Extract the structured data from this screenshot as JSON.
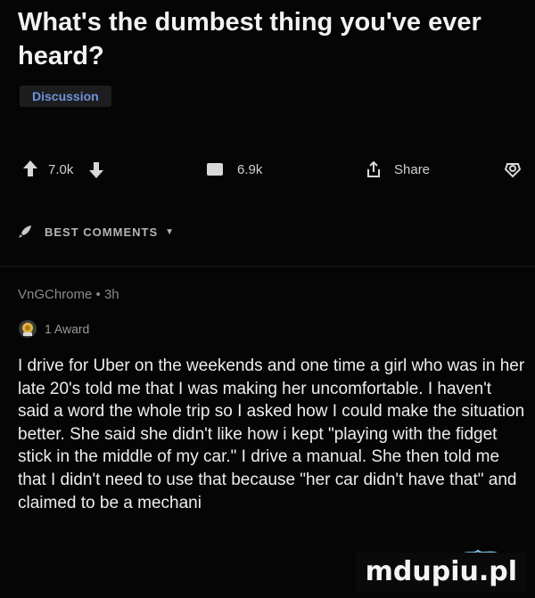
{
  "post": {
    "title": "What's the dumbest thing you've ever heard?",
    "flair": "Discussion"
  },
  "actions": {
    "upvote_icon": "arrow-up-icon",
    "score": "7.0k",
    "downvote_icon": "arrow-down-icon",
    "comment_icon": "comment-bubble-icon",
    "comment_count": "6.9k",
    "share_icon": "share-icon",
    "share_label": "Share",
    "award_icon": "gift-award-icon"
  },
  "sort": {
    "icon": "rocket-icon",
    "label": "BEST COMMENTS",
    "caret_icon": "chevron-down-icon"
  },
  "comment": {
    "author_time": "VnGChrome • 3h",
    "award_icon": "award-medal-icon",
    "award_text": "1 Award",
    "body": "I drive for Uber on the weekends and one time a girl who was in her late 20's told me that I was making her uncomfortable. I haven't said a word the whole trip so I asked how I could make the situation better. She said she didn't like how i kept \"playing with the fidget stick in the middle of my car.\" I drive a manual. She then told me that I didn't need to use that because \"her car didn't have that\" and claimed to be a mechani"
  },
  "watermark": {
    "text": "mdupiu.pl"
  },
  "colors": {
    "background": "#050505",
    "text": "#e6e6e6",
    "flair_text": "#6f93d8",
    "award_gold": "#e3b341"
  }
}
